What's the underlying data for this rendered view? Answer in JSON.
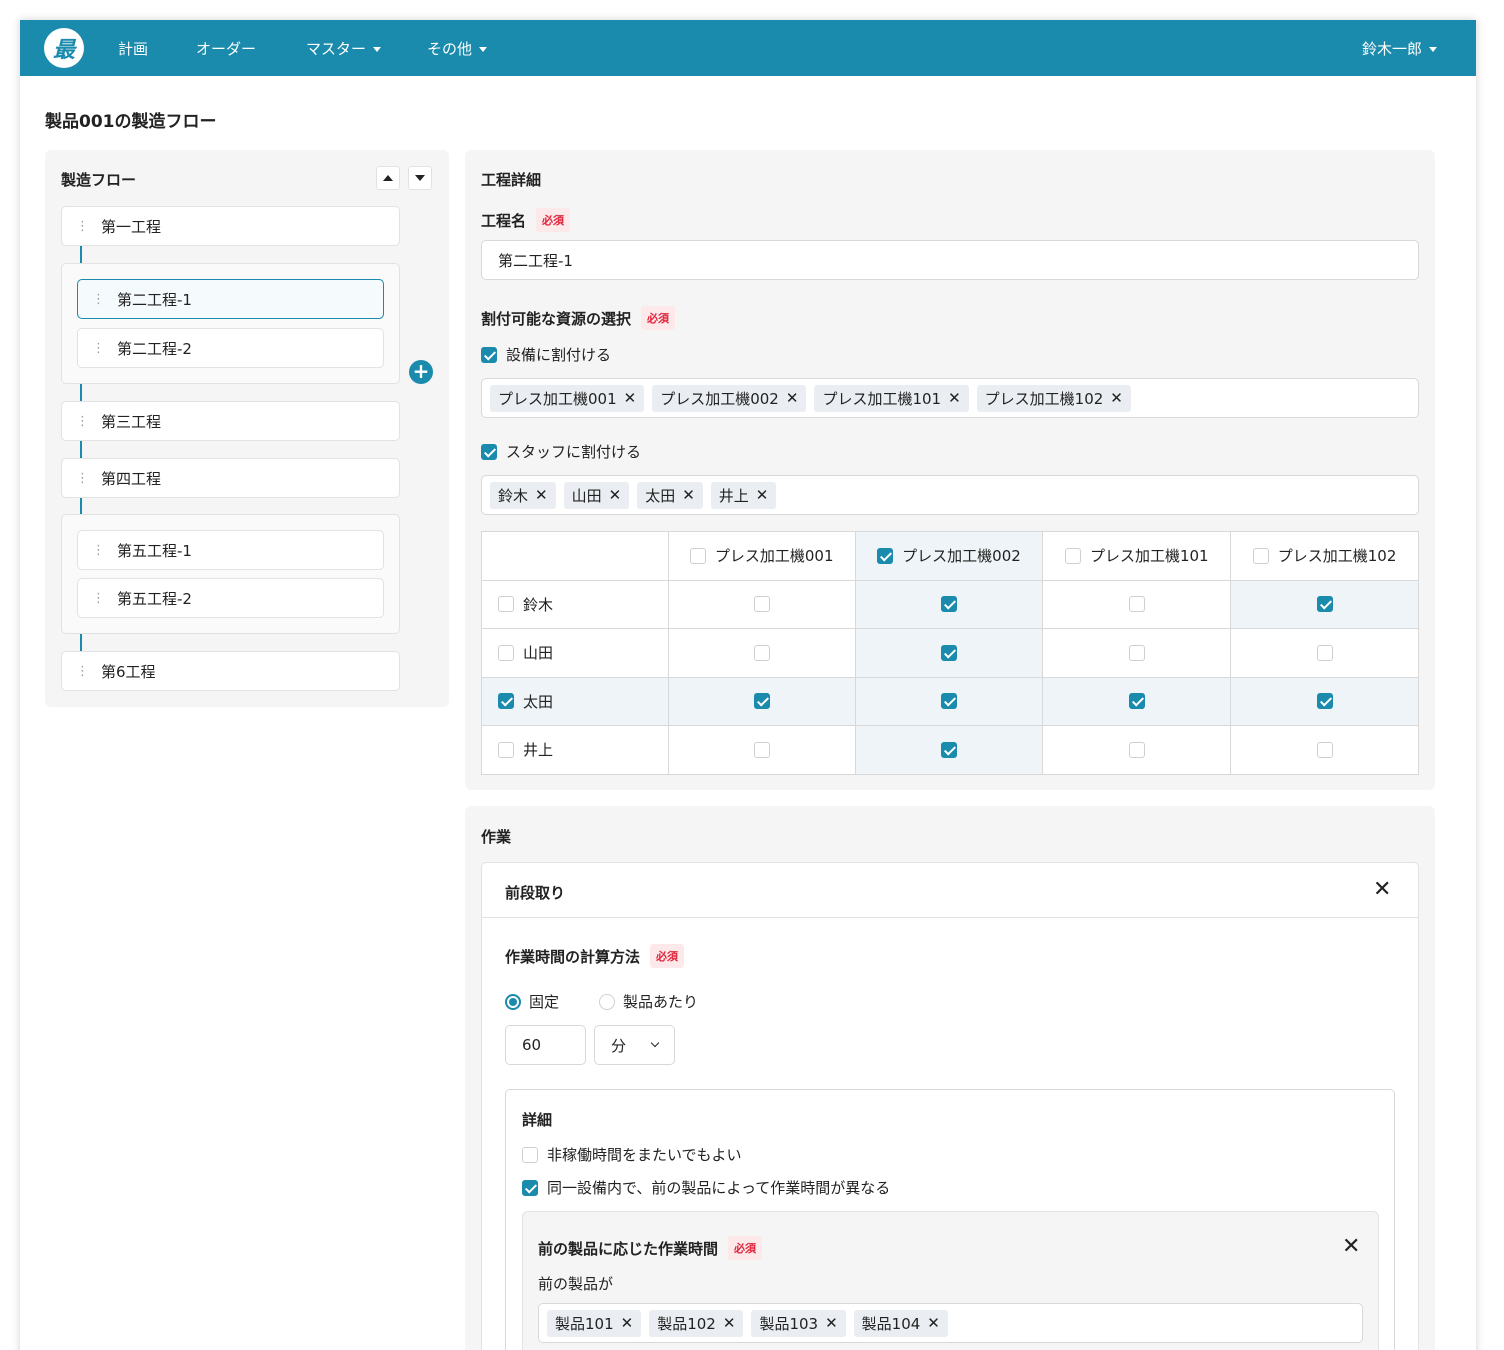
{
  "nav": {
    "logo": "最",
    "items": [
      "計画",
      "オーダー",
      "マスター",
      "その他"
    ],
    "user": "鈴木一郎"
  },
  "page_title": "製品001の製造フロー",
  "flow": {
    "title": "製造フロー",
    "steps": [
      "第一工程",
      "第二工程-1",
      "第二工程-2",
      "第三工程",
      "第四工程",
      "第五工程-1",
      "第五工程-2",
      "第6工程"
    ],
    "plus": "+"
  },
  "detail": {
    "title": "工程詳細",
    "name_label": "工程名",
    "required": "必須",
    "name_value": "第二工程-1",
    "resource_label": "割付可能な資源の選択",
    "equip_check_label": "設備に割付ける",
    "equip_tags": [
      "プレス加工機001",
      "プレス加工機002",
      "プレス加工機101",
      "プレス加工機102"
    ],
    "staff_check_label": "スタッフに割付ける",
    "staff_tags": [
      "鈴木",
      "山田",
      "太田",
      "井上"
    ],
    "matrix": {
      "columns": [
        "プレス加工機001",
        "プレス加工機002",
        "プレス加工機101",
        "プレス加工機102"
      ],
      "rows": [
        "鈴木",
        "山田",
        "太田",
        "井上"
      ]
    }
  },
  "work": {
    "title": "作業",
    "card_title": "前段取り",
    "calc_label": "作業時間の計算方法",
    "radio_fixed": "固定",
    "radio_per_product": "製品あたり",
    "time_value": "60",
    "unit": "分",
    "details_title": "詳細",
    "check_nonworking": "非稼働時間をまたいでもよい",
    "check_same_equipment": "同一設備内で、前の製品によって作業時間が異なる",
    "prev_title": "前の製品に応じた作業時間",
    "prev_label": "前の製品が",
    "prev_tags": [
      "製品101",
      "製品102",
      "製品103",
      "製品104"
    ]
  }
}
